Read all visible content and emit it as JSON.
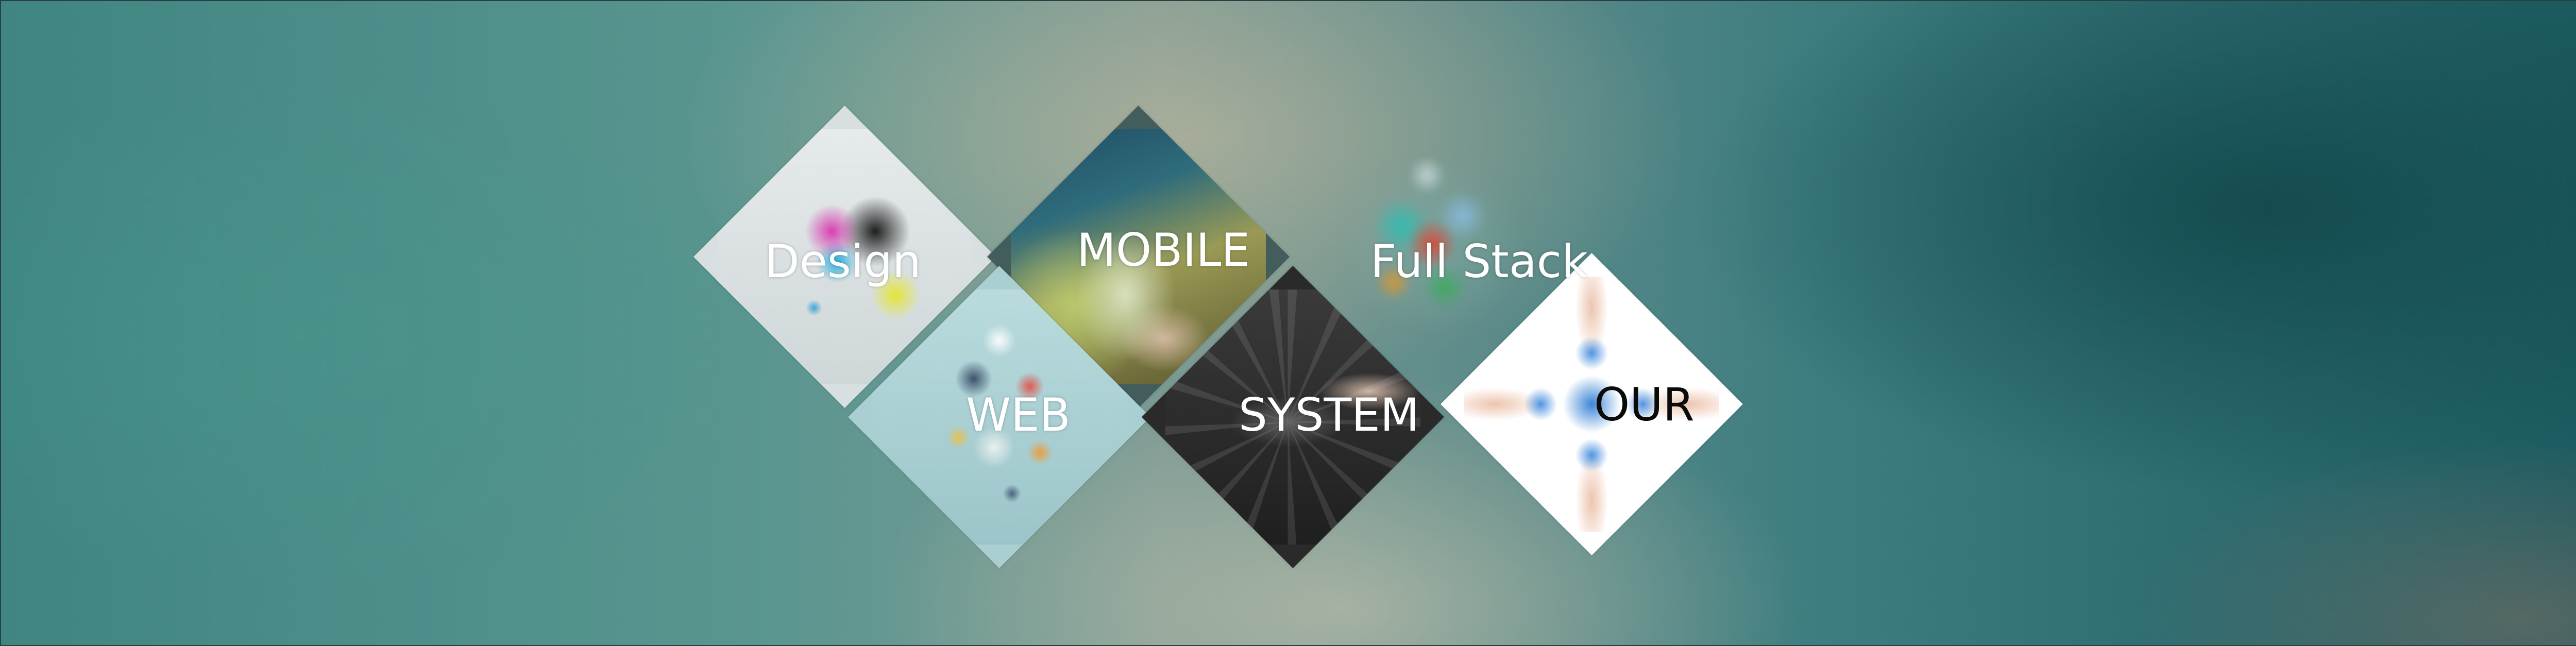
{
  "tiles": [
    {
      "id": "design",
      "label": "Design"
    },
    {
      "id": "mobile",
      "label": "MOBILE"
    },
    {
      "id": "fullstack",
      "label": "Full Stack"
    },
    {
      "id": "web",
      "label": "WEB"
    },
    {
      "id": "system",
      "label": "SYSTEM"
    },
    {
      "id": "our",
      "label": "OUR"
    }
  ],
  "colors": {
    "label_light": "#ffffff",
    "label_dark": "#0a0a0a",
    "background_teal": "#3f8582",
    "background_dark": "#1d5c62"
  }
}
